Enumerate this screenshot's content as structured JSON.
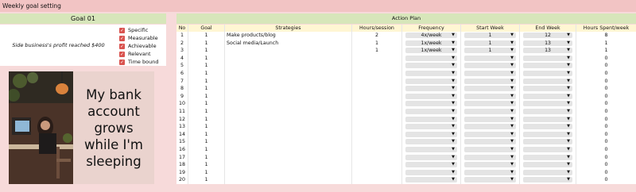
{
  "page_title": "Weekly goal setting",
  "goal": {
    "header": "Goal 01",
    "description": "Side business's profit reached $400",
    "smart": [
      "Specific",
      "Measurable",
      "Achievable",
      "Relevant",
      "Time bound"
    ]
  },
  "poster": {
    "text": "My bank\naccount\ngrows\nwhile I'm\nsleeping"
  },
  "action_plan": {
    "header": "Action Plan",
    "columns": [
      "No",
      "Goal",
      "Strategies",
      "Hours/session",
      "Frequency",
      "Start Week",
      "End Week",
      "Hours Spent/week"
    ],
    "rows": [
      {
        "no": "1",
        "goal": "1",
        "strategy": "Make products/blog",
        "hours": "2",
        "freq": "4x/week",
        "start": "1",
        "end": "12",
        "spent": "8"
      },
      {
        "no": "2",
        "goal": "1",
        "strategy": "Social media/Launch",
        "hours": "1",
        "freq": "1x/week",
        "start": "1",
        "end": "13",
        "spent": "1"
      },
      {
        "no": "3",
        "goal": "1",
        "strategy": "",
        "hours": "1",
        "freq": "1x/week",
        "start": "1",
        "end": "13",
        "spent": "1"
      },
      {
        "no": "4",
        "goal": "1",
        "strategy": "",
        "hours": "",
        "freq": "",
        "start": "",
        "end": "",
        "spent": "0"
      },
      {
        "no": "5",
        "goal": "1",
        "strategy": "",
        "hours": "",
        "freq": "",
        "start": "",
        "end": "",
        "spent": "0"
      },
      {
        "no": "6",
        "goal": "1",
        "strategy": "",
        "hours": "",
        "freq": "",
        "start": "",
        "end": "",
        "spent": "0"
      },
      {
        "no": "7",
        "goal": "1",
        "strategy": "",
        "hours": "",
        "freq": "",
        "start": "",
        "end": "",
        "spent": "0"
      },
      {
        "no": "8",
        "goal": "1",
        "strategy": "",
        "hours": "",
        "freq": "",
        "start": "",
        "end": "",
        "spent": "0"
      },
      {
        "no": "9",
        "goal": "1",
        "strategy": "",
        "hours": "",
        "freq": "",
        "start": "",
        "end": "",
        "spent": "0"
      },
      {
        "no": "10",
        "goal": "1",
        "strategy": "",
        "hours": "",
        "freq": "",
        "start": "",
        "end": "",
        "spent": "0"
      },
      {
        "no": "11",
        "goal": "1",
        "strategy": "",
        "hours": "",
        "freq": "",
        "start": "",
        "end": "",
        "spent": "0"
      },
      {
        "no": "12",
        "goal": "1",
        "strategy": "",
        "hours": "",
        "freq": "",
        "start": "",
        "end": "",
        "spent": "0"
      },
      {
        "no": "13",
        "goal": "1",
        "strategy": "",
        "hours": "",
        "freq": "",
        "start": "",
        "end": "",
        "spent": "0"
      },
      {
        "no": "14",
        "goal": "1",
        "strategy": "",
        "hours": "",
        "freq": "",
        "start": "",
        "end": "",
        "spent": "0"
      },
      {
        "no": "15",
        "goal": "1",
        "strategy": "",
        "hours": "",
        "freq": "",
        "start": "",
        "end": "",
        "spent": "0"
      },
      {
        "no": "16",
        "goal": "1",
        "strategy": "",
        "hours": "",
        "freq": "",
        "start": "",
        "end": "",
        "spent": "0"
      },
      {
        "no": "17",
        "goal": "1",
        "strategy": "",
        "hours": "",
        "freq": "",
        "start": "",
        "end": "",
        "spent": "0"
      },
      {
        "no": "18",
        "goal": "1",
        "strategy": "",
        "hours": "",
        "freq": "",
        "start": "",
        "end": "",
        "spent": "0"
      },
      {
        "no": "19",
        "goal": "1",
        "strategy": "",
        "hours": "",
        "freq": "",
        "start": "",
        "end": "",
        "spent": "0"
      },
      {
        "no": "20",
        "goal": "1",
        "strategy": "",
        "hours": "",
        "freq": "",
        "start": "",
        "end": "",
        "spent": "0"
      }
    ]
  },
  "colors": {
    "header_green": "#d7e6ba",
    "checkbox_red": "#d9534f",
    "page_pink": "#f7dada",
    "title_bar": "#f2c4c4"
  },
  "icons": {
    "checkbox": "checked-checkbox-icon",
    "dropdown": "dropdown-arrow-icon"
  }
}
